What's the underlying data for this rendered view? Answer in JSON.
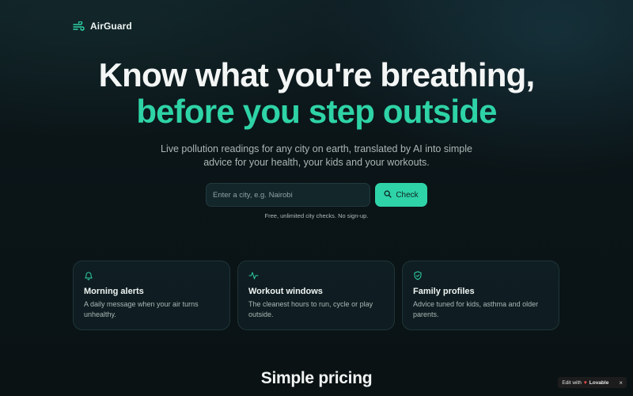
{
  "nav": {
    "brand": "AirGuard",
    "logo_icon": "wind-icon"
  },
  "hero": {
    "headline_line1": "Know what you're breathing,",
    "headline_line2": "before you step outside",
    "subtitle": "Live pollution readings for any city on earth, translated by AI into simple advice for your health, your kids and your workouts."
  },
  "search": {
    "placeholder": "Enter a city, e.g. Nairobi",
    "value": "",
    "button_label": "Check",
    "button_icon": "search-icon",
    "note": "Free, unlimited city checks. No sign-up."
  },
  "features": [
    {
      "icon": "bell-icon",
      "title": "Morning alerts",
      "text": "A daily message when your air turns unhealthy."
    },
    {
      "icon": "activity-icon",
      "title": "Workout windows",
      "text": "The cleanest hours to run, cycle or play outside."
    },
    {
      "icon": "shield-check-icon",
      "title": "Family profiles",
      "text": "Advice tuned for kids, asthma and older parents."
    }
  ],
  "pricing": {
    "heading": "Simple pricing"
  },
  "badge": {
    "prefix": "Edit with",
    "brand": "Lovable",
    "close": "×"
  },
  "colors": {
    "accent": "#2ed3a6",
    "background": "#0b1518",
    "card_border": "#1f3538"
  }
}
